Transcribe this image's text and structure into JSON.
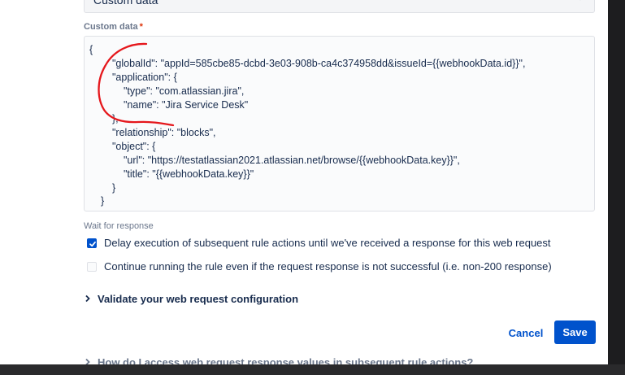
{
  "webhook_form": {
    "data_type_select": {
      "value": "Custom data"
    },
    "custom_data": {
      "label": "Custom data",
      "required_marker": "*",
      "lines": [
        "{",
        "\"globalId\": \"appId=585cbe85-dcbd-3e03-908b-ca4c374958dd&issueId={{webhookData.id}}\",",
        "\"application\": {",
        "\"type\": \"com.atlassian.jira\",",
        "\"name\": \"Jira Service Desk\"",
        "},",
        "\"relationship\": \"blocks\",",
        "\"object\": {",
        "\"url\": \"https://testatlassian2021.atlassian.net/browse/{{webhookData.key}}\",",
        "\"title\": \"{{webhookData.key}}\"",
        "}",
        "}"
      ]
    },
    "wait_for_response": {
      "label": "Wait for response",
      "options": [
        {
          "label": "Delay execution of subsequent rule actions until we've received a response for this web request",
          "checked": true
        },
        {
          "label": "Continue running the rule even if the request response is not successful (i.e. non-200 response)",
          "checked": false
        }
      ]
    },
    "validate_section": {
      "label": "Validate your web request configuration"
    },
    "actions": {
      "cancel_label": "Cancel",
      "save_label": "Save"
    },
    "help_section": {
      "label": "How do I access web request response values in subsequent rule actions?"
    }
  },
  "colors": {
    "accent": "#0052cc",
    "annotation": "#e5171c",
    "required": "#de350b"
  },
  "icons": [
    "chevron-down-icon",
    "checkmark-icon",
    "chevron-right-icon"
  ]
}
